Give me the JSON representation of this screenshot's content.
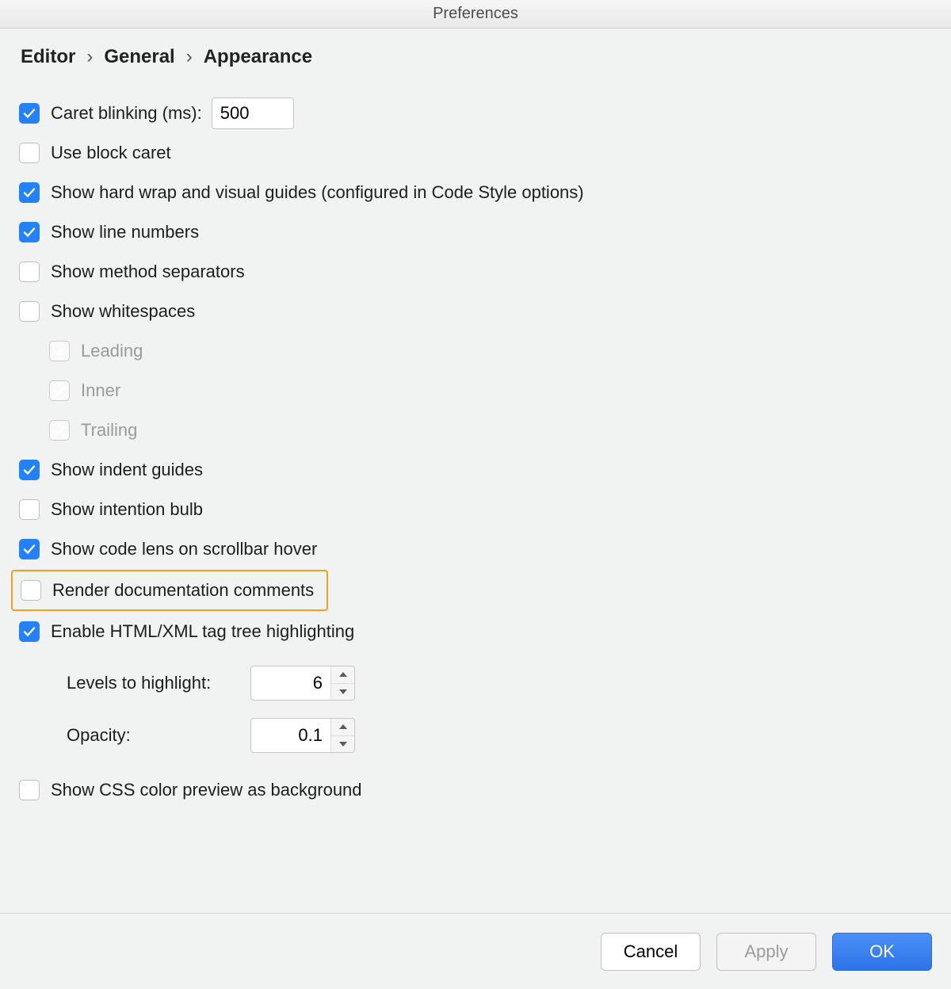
{
  "window": {
    "title": "Preferences"
  },
  "breadcrumb": {
    "a": "Editor",
    "b": "General",
    "c": "Appearance",
    "sep": "›"
  },
  "options": {
    "caret_blinking": {
      "label": "Caret blinking (ms):",
      "checked": true,
      "value": "500"
    },
    "use_block_caret": {
      "label": "Use block caret",
      "checked": false
    },
    "show_hard_wrap": {
      "label": "Show hard wrap and visual guides (configured in Code Style options)",
      "checked": true
    },
    "show_line_numbers": {
      "label": "Show line numbers",
      "checked": true
    },
    "show_method_separators": {
      "label": "Show method separators",
      "checked": false
    },
    "show_whitespaces": {
      "label": "Show whitespaces",
      "checked": false,
      "children": {
        "leading": {
          "label": "Leading",
          "checked": true,
          "disabled": true
        },
        "inner": {
          "label": "Inner",
          "checked": true,
          "disabled": true
        },
        "trailing": {
          "label": "Trailing",
          "checked": true,
          "disabled": true
        }
      }
    },
    "show_indent_guides": {
      "label": "Show indent guides",
      "checked": true
    },
    "show_intention_bulb": {
      "label": "Show intention bulb",
      "checked": false
    },
    "show_code_lens": {
      "label": "Show code lens on scrollbar hover",
      "checked": true
    },
    "render_doc_comments": {
      "label": "Render documentation comments",
      "checked": false,
      "highlighted": true
    },
    "enable_tag_tree": {
      "label": "Enable HTML/XML tag tree highlighting",
      "checked": true,
      "levels": {
        "label": "Levels to highlight:",
        "value": "6"
      },
      "opacity": {
        "label": "Opacity:",
        "value": "0.1"
      }
    },
    "show_css_color_preview": {
      "label": "Show CSS color preview as background",
      "checked": false
    }
  },
  "footer": {
    "cancel": "Cancel",
    "apply": "Apply",
    "ok": "OK"
  }
}
